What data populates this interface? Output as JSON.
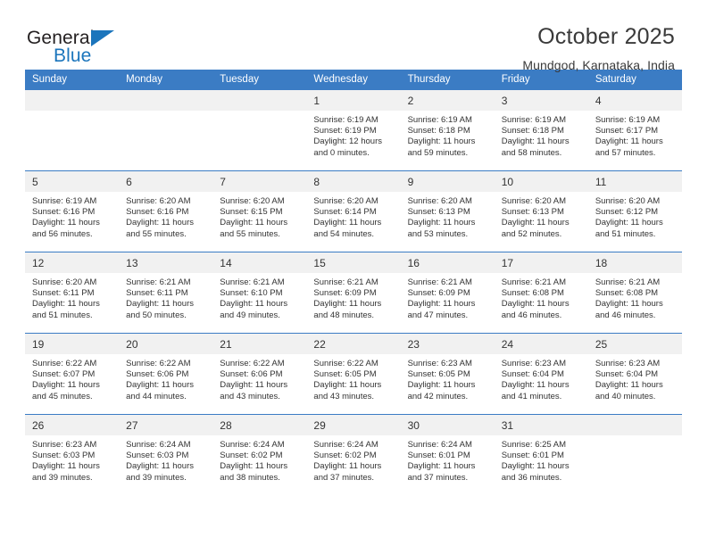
{
  "brand": {
    "name_part1": "General",
    "name_part2": "Blue",
    "accent_color": "#1b75bc"
  },
  "header": {
    "title": "October 2025",
    "subtitle": "Mundgod, Karnataka, India"
  },
  "calendar": {
    "header_color": "#3b7cc4",
    "daynum_band_color": "#f1f1f1",
    "weekday_headers": [
      "Sunday",
      "Monday",
      "Tuesday",
      "Wednesday",
      "Thursday",
      "Friday",
      "Saturday"
    ],
    "weeks": [
      [
        {
          "day": "",
          "lines": []
        },
        {
          "day": "",
          "lines": []
        },
        {
          "day": "",
          "lines": []
        },
        {
          "day": "1",
          "lines": [
            "Sunrise: 6:19 AM",
            "Sunset: 6:19 PM",
            "Daylight: 12 hours",
            "and 0 minutes."
          ]
        },
        {
          "day": "2",
          "lines": [
            "Sunrise: 6:19 AM",
            "Sunset: 6:18 PM",
            "Daylight: 11 hours",
            "and 59 minutes."
          ]
        },
        {
          "day": "3",
          "lines": [
            "Sunrise: 6:19 AM",
            "Sunset: 6:18 PM",
            "Daylight: 11 hours",
            "and 58 minutes."
          ]
        },
        {
          "day": "4",
          "lines": [
            "Sunrise: 6:19 AM",
            "Sunset: 6:17 PM",
            "Daylight: 11 hours",
            "and 57 minutes."
          ]
        }
      ],
      [
        {
          "day": "5",
          "lines": [
            "Sunrise: 6:19 AM",
            "Sunset: 6:16 PM",
            "Daylight: 11 hours",
            "and 56 minutes."
          ]
        },
        {
          "day": "6",
          "lines": [
            "Sunrise: 6:20 AM",
            "Sunset: 6:16 PM",
            "Daylight: 11 hours",
            "and 55 minutes."
          ]
        },
        {
          "day": "7",
          "lines": [
            "Sunrise: 6:20 AM",
            "Sunset: 6:15 PM",
            "Daylight: 11 hours",
            "and 55 minutes."
          ]
        },
        {
          "day": "8",
          "lines": [
            "Sunrise: 6:20 AM",
            "Sunset: 6:14 PM",
            "Daylight: 11 hours",
            "and 54 minutes."
          ]
        },
        {
          "day": "9",
          "lines": [
            "Sunrise: 6:20 AM",
            "Sunset: 6:13 PM",
            "Daylight: 11 hours",
            "and 53 minutes."
          ]
        },
        {
          "day": "10",
          "lines": [
            "Sunrise: 6:20 AM",
            "Sunset: 6:13 PM",
            "Daylight: 11 hours",
            "and 52 minutes."
          ]
        },
        {
          "day": "11",
          "lines": [
            "Sunrise: 6:20 AM",
            "Sunset: 6:12 PM",
            "Daylight: 11 hours",
            "and 51 minutes."
          ]
        }
      ],
      [
        {
          "day": "12",
          "lines": [
            "Sunrise: 6:20 AM",
            "Sunset: 6:11 PM",
            "Daylight: 11 hours",
            "and 51 minutes."
          ]
        },
        {
          "day": "13",
          "lines": [
            "Sunrise: 6:21 AM",
            "Sunset: 6:11 PM",
            "Daylight: 11 hours",
            "and 50 minutes."
          ]
        },
        {
          "day": "14",
          "lines": [
            "Sunrise: 6:21 AM",
            "Sunset: 6:10 PM",
            "Daylight: 11 hours",
            "and 49 minutes."
          ]
        },
        {
          "day": "15",
          "lines": [
            "Sunrise: 6:21 AM",
            "Sunset: 6:09 PM",
            "Daylight: 11 hours",
            "and 48 minutes."
          ]
        },
        {
          "day": "16",
          "lines": [
            "Sunrise: 6:21 AM",
            "Sunset: 6:09 PM",
            "Daylight: 11 hours",
            "and 47 minutes."
          ]
        },
        {
          "day": "17",
          "lines": [
            "Sunrise: 6:21 AM",
            "Sunset: 6:08 PM",
            "Daylight: 11 hours",
            "and 46 minutes."
          ]
        },
        {
          "day": "18",
          "lines": [
            "Sunrise: 6:21 AM",
            "Sunset: 6:08 PM",
            "Daylight: 11 hours",
            "and 46 minutes."
          ]
        }
      ],
      [
        {
          "day": "19",
          "lines": [
            "Sunrise: 6:22 AM",
            "Sunset: 6:07 PM",
            "Daylight: 11 hours",
            "and 45 minutes."
          ]
        },
        {
          "day": "20",
          "lines": [
            "Sunrise: 6:22 AM",
            "Sunset: 6:06 PM",
            "Daylight: 11 hours",
            "and 44 minutes."
          ]
        },
        {
          "day": "21",
          "lines": [
            "Sunrise: 6:22 AM",
            "Sunset: 6:06 PM",
            "Daylight: 11 hours",
            "and 43 minutes."
          ]
        },
        {
          "day": "22",
          "lines": [
            "Sunrise: 6:22 AM",
            "Sunset: 6:05 PM",
            "Daylight: 11 hours",
            "and 43 minutes."
          ]
        },
        {
          "day": "23",
          "lines": [
            "Sunrise: 6:23 AM",
            "Sunset: 6:05 PM",
            "Daylight: 11 hours",
            "and 42 minutes."
          ]
        },
        {
          "day": "24",
          "lines": [
            "Sunrise: 6:23 AM",
            "Sunset: 6:04 PM",
            "Daylight: 11 hours",
            "and 41 minutes."
          ]
        },
        {
          "day": "25",
          "lines": [
            "Sunrise: 6:23 AM",
            "Sunset: 6:04 PM",
            "Daylight: 11 hours",
            "and 40 minutes."
          ]
        }
      ],
      [
        {
          "day": "26",
          "lines": [
            "Sunrise: 6:23 AM",
            "Sunset: 6:03 PM",
            "Daylight: 11 hours",
            "and 39 minutes."
          ]
        },
        {
          "day": "27",
          "lines": [
            "Sunrise: 6:24 AM",
            "Sunset: 6:03 PM",
            "Daylight: 11 hours",
            "and 39 minutes."
          ]
        },
        {
          "day": "28",
          "lines": [
            "Sunrise: 6:24 AM",
            "Sunset: 6:02 PM",
            "Daylight: 11 hours",
            "and 38 minutes."
          ]
        },
        {
          "day": "29",
          "lines": [
            "Sunrise: 6:24 AM",
            "Sunset: 6:02 PM",
            "Daylight: 11 hours",
            "and 37 minutes."
          ]
        },
        {
          "day": "30",
          "lines": [
            "Sunrise: 6:24 AM",
            "Sunset: 6:01 PM",
            "Daylight: 11 hours",
            "and 37 minutes."
          ]
        },
        {
          "day": "31",
          "lines": [
            "Sunrise: 6:25 AM",
            "Sunset: 6:01 PM",
            "Daylight: 11 hours",
            "and 36 minutes."
          ]
        },
        {
          "day": "",
          "lines": []
        }
      ]
    ]
  }
}
